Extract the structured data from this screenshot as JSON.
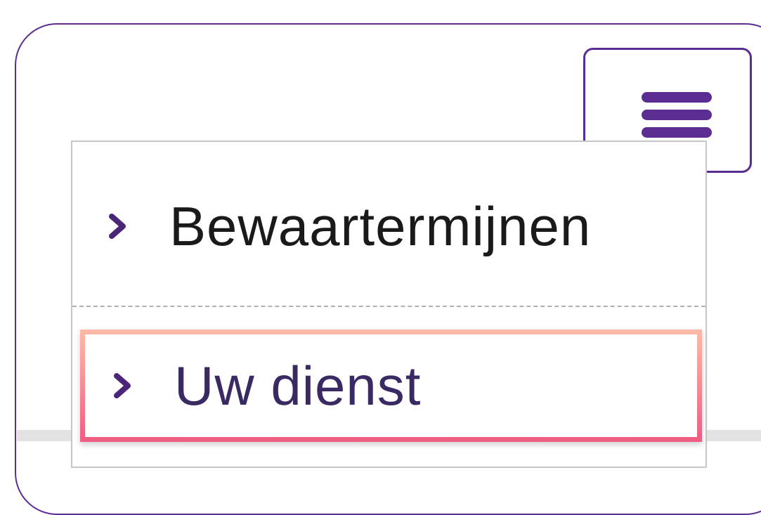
{
  "menu": {
    "toggle_icon": "hamburger-icon",
    "items": [
      {
        "label": "Bewaartermijnen",
        "icon": "chevron-right-icon"
      },
      {
        "label": "Uw dienst",
        "icon": "chevron-right-icon",
        "highlighted": true
      }
    ]
  },
  "colors": {
    "brand": "#5c2d91",
    "highlight_top": "#ffb7a6",
    "highlight_bottom": "#ef5f83"
  }
}
